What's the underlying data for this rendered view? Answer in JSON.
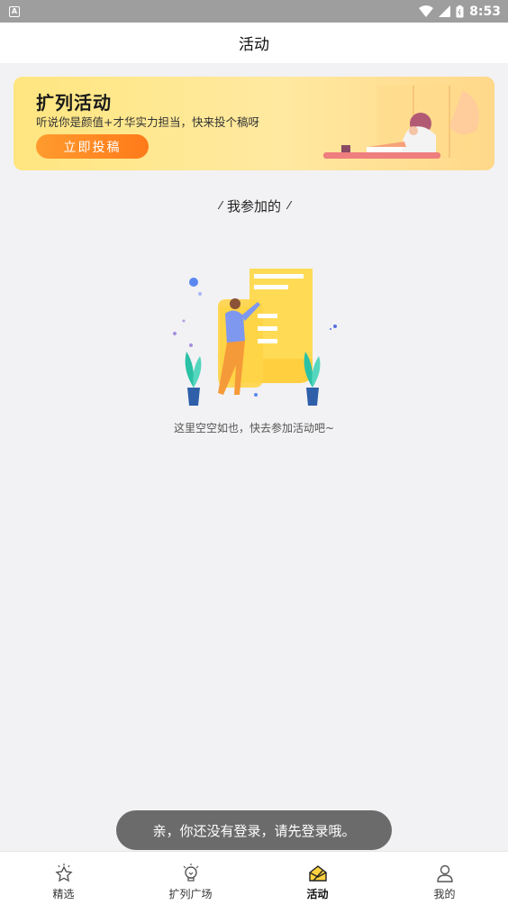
{
  "status_bar": {
    "time": "8:53",
    "notification_glyph": "A",
    "icons": [
      "wifi-icon",
      "signal-icon",
      "battery-icon"
    ]
  },
  "header": {
    "title": "活动"
  },
  "banner": {
    "title": "扩列活动",
    "subtitle": "听说你是颜值+才华实力担当，快来投个稿呀",
    "button_label": "立即投稿"
  },
  "section": {
    "title": "我参加的"
  },
  "empty_state": {
    "text": "这里空空如也，快去参加活动吧~"
  },
  "toast": {
    "text": "亲，你还没有登录，请先登录哦。"
  },
  "bottom_nav": {
    "items": [
      {
        "label": "精选",
        "icon": "star-icon",
        "active": false
      },
      {
        "label": "扩列广场",
        "icon": "lightbulb-icon",
        "active": false
      },
      {
        "label": "活动",
        "icon": "envelope-icon",
        "active": true
      },
      {
        "label": "我的",
        "icon": "person-icon",
        "active": false
      }
    ]
  },
  "colors": {
    "accent": "#ffd23f",
    "button_orange": "#ff8a22",
    "background": "#f2f2f4",
    "toast_bg": "#6b6b6b"
  }
}
